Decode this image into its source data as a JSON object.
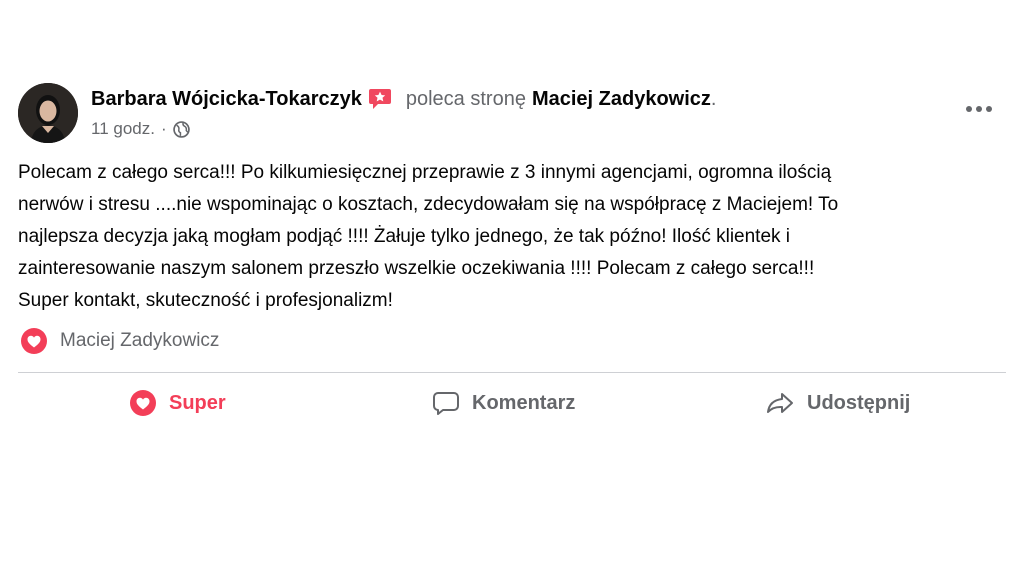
{
  "post": {
    "author": "Barbara Wójcicka-Tokarczyk",
    "verb": "poleca stronę",
    "page_name": "Maciej Zadykowicz",
    "period": ".",
    "time": "11 godz.",
    "separator": "·",
    "body_lines": [
      "Polecam z całego serca!!! Po kilkumiesięcznej przeprawie z 3 innymi agencjami, ogromna ilością",
      "nerwów i stresu ....nie wspominając o kosztach, zdecydowałam się na współpracę z Maciejem! To",
      "najlepsza decyzja jaką mogłam podjąć !!!! Żałuje tylko jednego, że tak późno! Ilość klientek i",
      "zainteresowanie naszym salonem przeszło wszelkie oczekiwania !!!! Polecam z całego serca!!!",
      "Super kontakt, skuteczność i profesjonalizm!"
    ],
    "reactions_name": "Maciej Zadykowicz"
  },
  "actions": {
    "like_label": "Super",
    "comment_label": "Komentarz",
    "share_label": "Udostępnij"
  },
  "icons": {
    "recommend_badge": "recommend-star-icon",
    "audience": "globe-icon",
    "more": "more-options-icon",
    "reaction": "heart-icon",
    "comment": "comment-icon",
    "share": "share-icon"
  },
  "colors": {
    "accent_love": "#f33e58",
    "secondary_text": "#65676b",
    "primary_text": "#050505",
    "divider": "#ced0d4"
  }
}
